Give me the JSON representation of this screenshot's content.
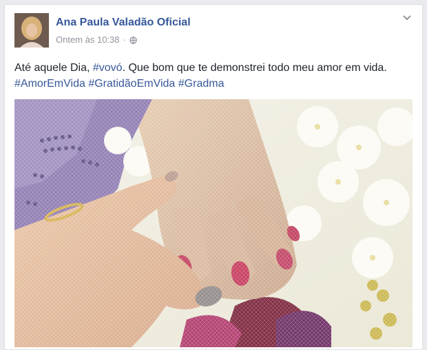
{
  "post": {
    "author": "Ana Paula Valadão Oficial",
    "timestamp": "Ontem às 10:38",
    "separator": "·",
    "privacy_icon": "globe-icon",
    "options_icon": "chevron-down-icon",
    "text_part1": "Até aquele Dia, ",
    "hashtag_vovo": "#vovó",
    "text_part2": ". Que bom que te demonstrei todo meu amor em vida. ",
    "hashtags": [
      "#AmorEmVida",
      "#GratidãoEmVida",
      "#Gradma"
    ]
  },
  "colors": {
    "link": "#365899",
    "text": "#1d2129",
    "meta": "#90949c"
  }
}
